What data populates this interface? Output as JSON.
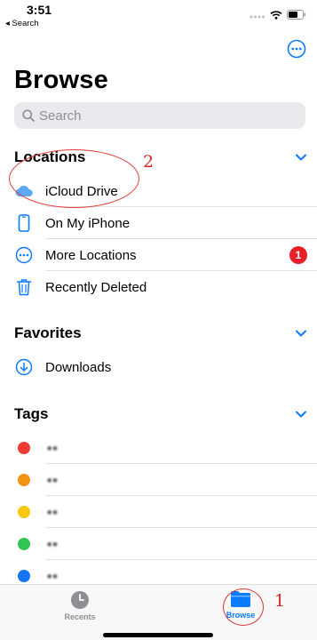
{
  "status_bar": {
    "time": "3:51",
    "back_app": "◂ Search"
  },
  "header": {
    "title": "Browse",
    "more_icon": "ellipsis-circle-icon"
  },
  "search": {
    "placeholder": "Search"
  },
  "sections": {
    "locations": {
      "title": "Locations",
      "items": [
        {
          "label": "iCloud Drive",
          "icon": "icloud-icon"
        },
        {
          "label": "On My iPhone",
          "icon": "iphone-icon"
        },
        {
          "label": "More Locations",
          "icon": "ellipsis-circle-icon",
          "badge": "1"
        },
        {
          "label": "Recently Deleted",
          "icon": "trash-icon"
        }
      ]
    },
    "favorites": {
      "title": "Favorites",
      "items": [
        {
          "label": "Downloads",
          "icon": "download-circle-icon"
        }
      ]
    },
    "tags": {
      "title": "Tags",
      "items": [
        {
          "color": "#ef3b35",
          "label": "▪▪"
        },
        {
          "color": "#f39217",
          "label": "▪▪"
        },
        {
          "color": "#f7c710",
          "label": "▪▪"
        },
        {
          "color": "#32c553",
          "label": "▪▪"
        },
        {
          "color": "#1476f4",
          "label": "▪▪"
        }
      ]
    }
  },
  "annotations": {
    "browse_number": "1",
    "icloud_number": "2"
  },
  "tab_bar": {
    "recents_label": "Recents",
    "browse_label": "Browse"
  },
  "colors": {
    "accent": "#0a7aff",
    "annotation": "#e03a3a",
    "badge": "#e8202a"
  }
}
